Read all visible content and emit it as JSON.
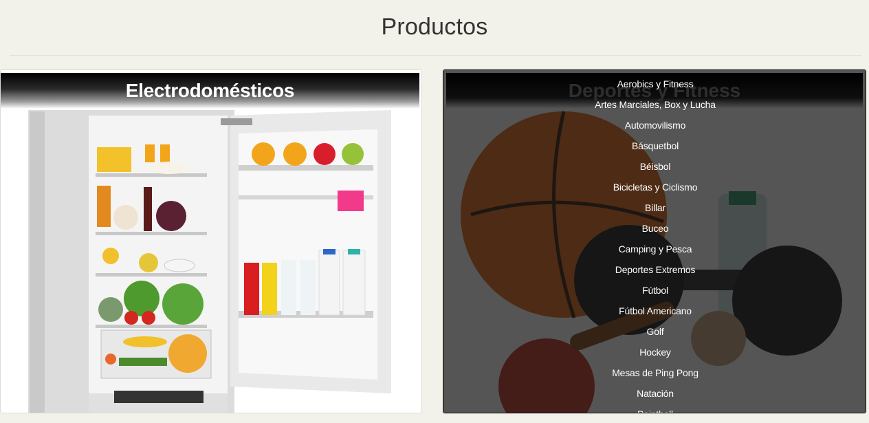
{
  "page": {
    "title": "Productos"
  },
  "cards": {
    "appliances": {
      "label": "Electrodomésticos"
    },
    "sports": {
      "label": "Deportes y Fitness",
      "categories": [
        "Aerobics y Fitness",
        "Artes Marciales, Box y Lucha",
        "Automovilismo",
        "Básquetbol",
        "Béisbol",
        "Bicicletas y Ciclismo",
        "Billar",
        "Buceo",
        "Camping y Pesca",
        "Deportes Extremos",
        "Fútbol",
        "Fútbol Americano",
        "Golf",
        "Hockey",
        "Mesas de Ping Pong",
        "Natación",
        "Paintball"
      ]
    }
  },
  "colors": {
    "background": "#f2f1ea",
    "title_text": "#333333",
    "sports_card_bg": "#1e1e1e"
  }
}
